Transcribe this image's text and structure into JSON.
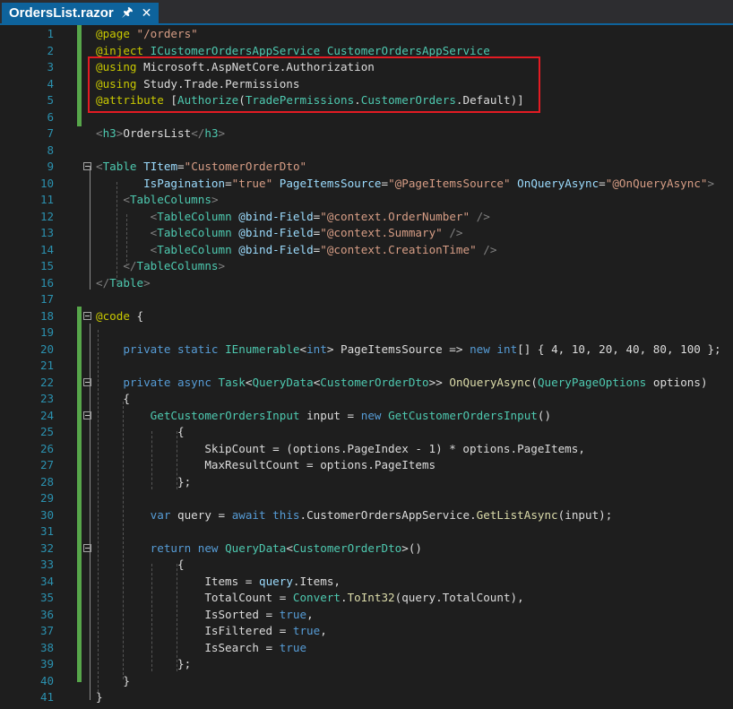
{
  "tab": {
    "filename": "OrdersList.razor",
    "pin_icon": "pin-icon",
    "close_icon": "close-icon"
  },
  "colors": {
    "keyword": "#569cd6",
    "type": "#4ec9b0",
    "string": "#d69d85",
    "razor": "#c8c800",
    "attr": "#9cdcfe",
    "method": "#dcdcaa",
    "punct": "#dcdcdc",
    "html": "#808080",
    "tag": "#4ec9b0",
    "linenumber": "#2b91af",
    "accent_tab": "#0e639c",
    "highlight_box": "#e31b23",
    "change_bar": "#57a64a"
  },
  "lines": [
    {
      "n": "1",
      "tokens": [
        [
          "razor",
          "@page "
        ],
        [
          "string",
          "\"/orders\""
        ]
      ]
    },
    {
      "n": "2",
      "tokens": [
        [
          "razor",
          "@inject "
        ],
        [
          "type",
          "ICustomerOrdersAppService"
        ],
        [
          "p",
          " "
        ],
        [
          "type",
          "CustomerOrdersAppService"
        ]
      ]
    },
    {
      "n": "3",
      "tokens": [
        [
          "razor",
          "@using "
        ],
        [
          "p",
          "Microsoft.AspNetCore.Authorization"
        ]
      ]
    },
    {
      "n": "4",
      "tokens": [
        [
          "razor",
          "@using "
        ],
        [
          "p",
          "Study.Trade.Permissions"
        ]
      ]
    },
    {
      "n": "5",
      "tokens": [
        [
          "razor",
          "@attribute "
        ],
        [
          "p",
          "["
        ],
        [
          "type",
          "Authorize"
        ],
        [
          "p",
          "("
        ],
        [
          "type",
          "TradePermissions"
        ],
        [
          "p",
          "."
        ],
        [
          "type",
          "CustomerOrders"
        ],
        [
          "p",
          ".Default)]"
        ]
      ]
    },
    {
      "n": "6",
      "tokens": []
    },
    {
      "n": "7",
      "tokens": [
        [
          "html",
          "<"
        ],
        [
          "tag",
          "h3"
        ],
        [
          "html",
          ">"
        ],
        [
          "p",
          "OrdersList"
        ],
        [
          "html",
          "</"
        ],
        [
          "tag",
          "h3"
        ],
        [
          "html",
          ">"
        ]
      ]
    },
    {
      "n": "8",
      "tokens": []
    },
    {
      "n": "9",
      "tokens": [
        [
          "html",
          "<"
        ],
        [
          "tag",
          "Table"
        ],
        [
          "p",
          " "
        ],
        [
          "attr",
          "TItem"
        ],
        [
          "p",
          "="
        ],
        [
          "string",
          "\"CustomerOrderDto\""
        ]
      ]
    },
    {
      "n": "10",
      "tokens": [
        [
          "p",
          "       "
        ],
        [
          "attr",
          "IsPagination"
        ],
        [
          "p",
          "="
        ],
        [
          "string",
          "\"true\""
        ],
        [
          "p",
          " "
        ],
        [
          "attr",
          "PageItemsSource"
        ],
        [
          "p",
          "="
        ],
        [
          "string",
          "\"@PageItemsSource\""
        ],
        [
          "p",
          " "
        ],
        [
          "attr",
          "OnQueryAsync"
        ],
        [
          "p",
          "="
        ],
        [
          "string",
          "\"@OnQueryAsync\""
        ],
        [
          "html",
          ">"
        ]
      ]
    },
    {
      "n": "11",
      "tokens": [
        [
          "p",
          "    "
        ],
        [
          "html",
          "<"
        ],
        [
          "tag",
          "TableColumns"
        ],
        [
          "html",
          ">"
        ]
      ]
    },
    {
      "n": "12",
      "tokens": [
        [
          "p",
          "        "
        ],
        [
          "html",
          "<"
        ],
        [
          "tag",
          "TableColumn"
        ],
        [
          "p",
          " "
        ],
        [
          "attr",
          "@bind-Field"
        ],
        [
          "p",
          "="
        ],
        [
          "string",
          "\"@context.OrderNumber\""
        ],
        [
          "p",
          " "
        ],
        [
          "html",
          "/>"
        ]
      ]
    },
    {
      "n": "13",
      "tokens": [
        [
          "p",
          "        "
        ],
        [
          "html",
          "<"
        ],
        [
          "tag",
          "TableColumn"
        ],
        [
          "p",
          " "
        ],
        [
          "attr",
          "@bind-Field"
        ],
        [
          "p",
          "="
        ],
        [
          "string",
          "\"@context.Summary\""
        ],
        [
          "p",
          " "
        ],
        [
          "html",
          "/>"
        ]
      ]
    },
    {
      "n": "14",
      "tokens": [
        [
          "p",
          "        "
        ],
        [
          "html",
          "<"
        ],
        [
          "tag",
          "TableColumn"
        ],
        [
          "p",
          " "
        ],
        [
          "attr",
          "@bind-Field"
        ],
        [
          "p",
          "="
        ],
        [
          "string",
          "\"@context.CreationTime\""
        ],
        [
          "p",
          " "
        ],
        [
          "html",
          "/>"
        ]
      ]
    },
    {
      "n": "15",
      "tokens": [
        [
          "p",
          "    "
        ],
        [
          "html",
          "</"
        ],
        [
          "tag",
          "TableColumns"
        ],
        [
          "html",
          ">"
        ]
      ]
    },
    {
      "n": "16",
      "tokens": [
        [
          "html",
          "</"
        ],
        [
          "tag",
          "Table"
        ],
        [
          "html",
          ">"
        ]
      ]
    },
    {
      "n": "17",
      "tokens": []
    },
    {
      "n": "18",
      "tokens": [
        [
          "razor",
          "@code"
        ],
        [
          "p",
          " {"
        ]
      ]
    },
    {
      "n": "19",
      "tokens": []
    },
    {
      "n": "20",
      "tokens": [
        [
          "p",
          "    "
        ],
        [
          "keyword",
          "private static "
        ],
        [
          "type",
          "IEnumerable"
        ],
        [
          "p",
          "<"
        ],
        [
          "keyword",
          "int"
        ],
        [
          "p",
          "> PageItemsSource => "
        ],
        [
          "keyword",
          "new "
        ],
        [
          "keyword",
          "int"
        ],
        [
          "p",
          "[] { 4, 10, 20, 40, 80, 100 };"
        ]
      ]
    },
    {
      "n": "21",
      "tokens": []
    },
    {
      "n": "22",
      "tokens": [
        [
          "p",
          "    "
        ],
        [
          "keyword",
          "private async "
        ],
        [
          "type",
          "Task"
        ],
        [
          "p",
          "<"
        ],
        [
          "type",
          "QueryData"
        ],
        [
          "p",
          "<"
        ],
        [
          "type",
          "CustomerOrderDto"
        ],
        [
          "p",
          ">> "
        ],
        [
          "method",
          "OnQueryAsync"
        ],
        [
          "p",
          "("
        ],
        [
          "type",
          "QueryPageOptions"
        ],
        [
          "p",
          " options)"
        ]
      ]
    },
    {
      "n": "23",
      "tokens": [
        [
          "p",
          "    {"
        ]
      ]
    },
    {
      "n": "24",
      "tokens": [
        [
          "p",
          "        "
        ],
        [
          "type",
          "GetCustomerOrdersInput"
        ],
        [
          "p",
          " input = "
        ],
        [
          "keyword",
          "new "
        ],
        [
          "type",
          "GetCustomerOrdersInput"
        ],
        [
          "p",
          "()"
        ]
      ]
    },
    {
      "n": "25",
      "tokens": [
        [
          "p",
          "            {"
        ]
      ]
    },
    {
      "n": "26",
      "tokens": [
        [
          "p",
          "                SkipCount = (options.PageIndex - 1) * options.PageItems,"
        ]
      ]
    },
    {
      "n": "27",
      "tokens": [
        [
          "p",
          "                MaxResultCount = options.PageItems"
        ]
      ]
    },
    {
      "n": "28",
      "tokens": [
        [
          "p",
          "            };"
        ]
      ]
    },
    {
      "n": "29",
      "tokens": []
    },
    {
      "n": "30",
      "tokens": [
        [
          "p",
          "        "
        ],
        [
          "keyword",
          "var "
        ],
        [
          "p",
          "query = "
        ],
        [
          "keyword",
          "await this"
        ],
        [
          "p",
          ".CustomerOrdersAppService."
        ],
        [
          "method",
          "GetListAsync"
        ],
        [
          "p",
          "(input);"
        ]
      ]
    },
    {
      "n": "31",
      "tokens": []
    },
    {
      "n": "32",
      "tokens": [
        [
          "p",
          "        "
        ],
        [
          "keyword",
          "return new "
        ],
        [
          "type",
          "QueryData"
        ],
        [
          "p",
          "<"
        ],
        [
          "type",
          "CustomerOrderDto"
        ],
        [
          "p",
          ">()"
        ]
      ]
    },
    {
      "n": "33",
      "tokens": [
        [
          "p",
          "            {"
        ]
      ]
    },
    {
      "n": "34",
      "tokens": [
        [
          "p",
          "                Items = "
        ],
        [
          "attr",
          "query"
        ],
        [
          "p",
          ".Items,"
        ]
      ]
    },
    {
      "n": "35",
      "tokens": [
        [
          "p",
          "                TotalCount = "
        ],
        [
          "type",
          "Convert"
        ],
        [
          "p",
          "."
        ],
        [
          "method",
          "ToInt32"
        ],
        [
          "p",
          "(query.TotalCount),"
        ]
      ]
    },
    {
      "n": "36",
      "tokens": [
        [
          "p",
          "                IsSorted = "
        ],
        [
          "keyword",
          "true"
        ],
        [
          "p",
          ","
        ]
      ]
    },
    {
      "n": "37",
      "tokens": [
        [
          "p",
          "                IsFiltered = "
        ],
        [
          "keyword",
          "true"
        ],
        [
          "p",
          ","
        ]
      ]
    },
    {
      "n": "38",
      "tokens": [
        [
          "p",
          "                IsSearch = "
        ],
        [
          "keyword",
          "true"
        ]
      ]
    },
    {
      "n": "39",
      "tokens": [
        [
          "p",
          "            };"
        ]
      ]
    },
    {
      "n": "40",
      "tokens": [
        [
          "p",
          "    }"
        ]
      ]
    },
    {
      "n": "41",
      "tokens": [
        [
          "p",
          "}"
        ]
      ]
    }
  ]
}
